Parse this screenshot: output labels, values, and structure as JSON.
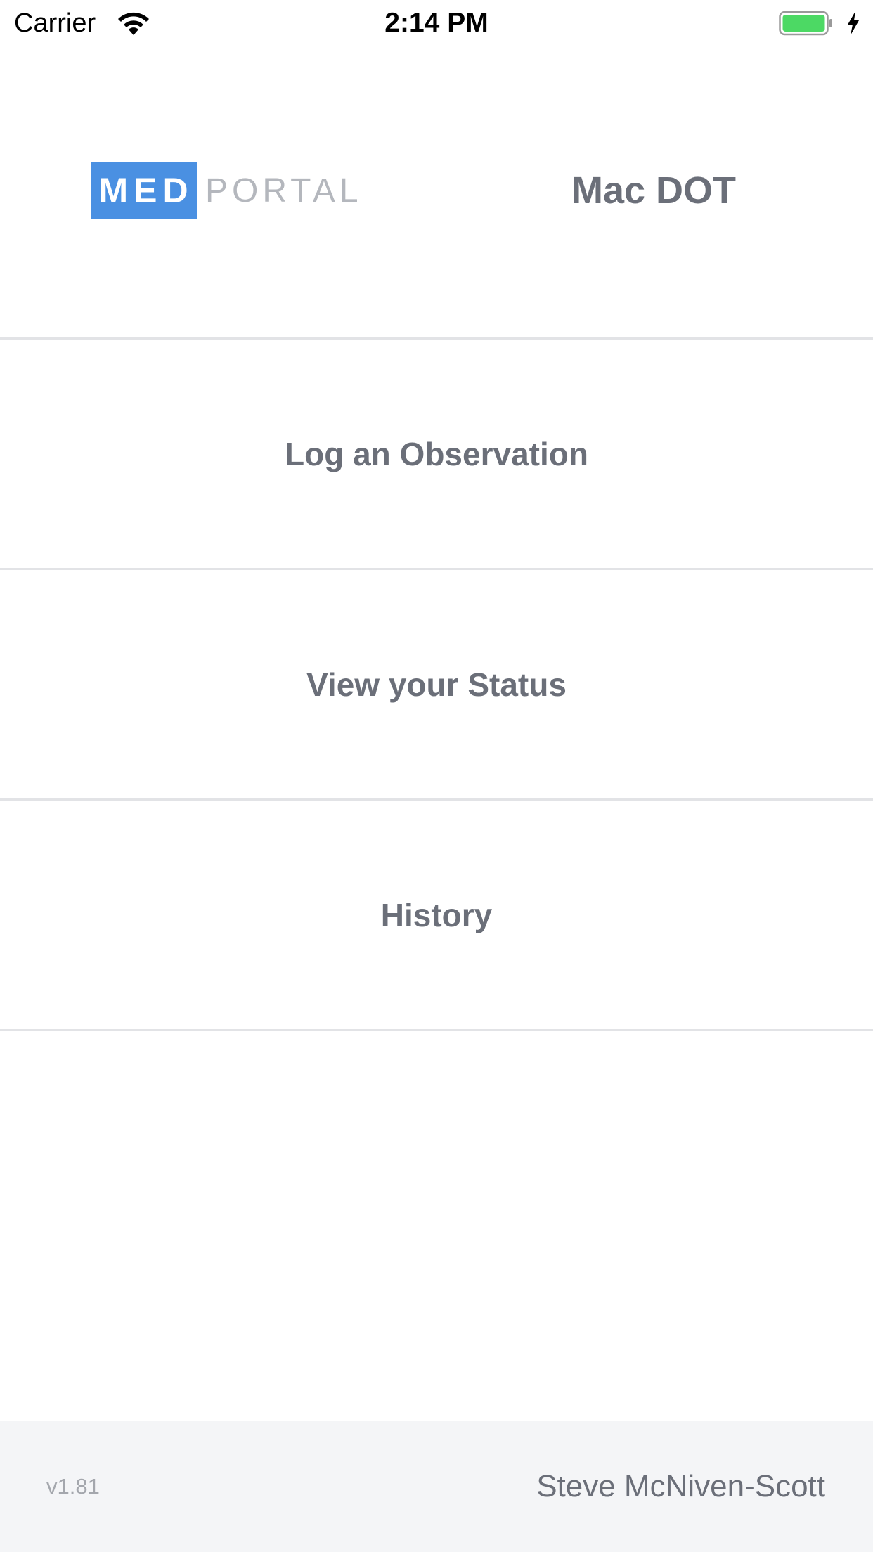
{
  "status_bar": {
    "carrier": "Carrier",
    "time": "2:14 PM",
    "wifi_icon": "wifi-icon",
    "battery_icon": "battery-charging-icon",
    "battery_level": 1.0,
    "battery_color": "#4CD964"
  },
  "header": {
    "logo": {
      "part1": "MED",
      "part2": "PORTAL",
      "brand_color": "#4A90E2"
    },
    "app_name": "Mac DOT"
  },
  "menu": {
    "items": [
      {
        "label": "Log an Observation"
      },
      {
        "label": "View your Status"
      },
      {
        "label": "History"
      }
    ]
  },
  "footer": {
    "version": "v1.81",
    "user_name": "Steve McNiven-Scott"
  }
}
